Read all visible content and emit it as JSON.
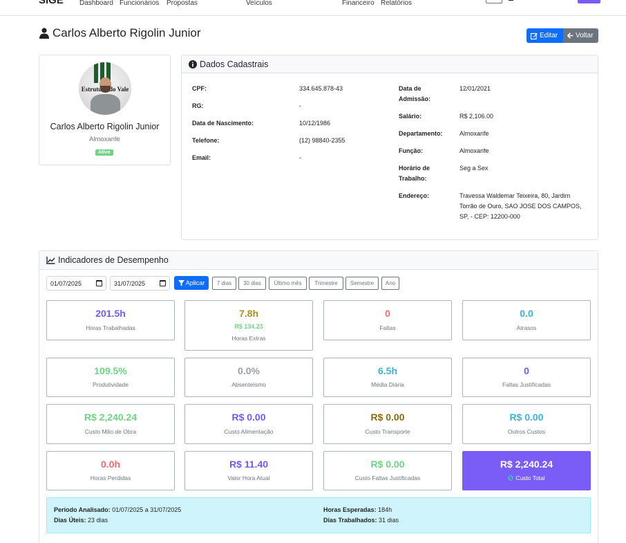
{
  "nav": {
    "brand": "SIGE",
    "links": [
      "Dashboard",
      "Funcionários",
      "Propostas",
      "Veículos",
      "Financeiro",
      "Relatórios"
    ]
  },
  "page": {
    "title": "Carlos Alberto Rigolin Junior",
    "edit_label": "Editar",
    "back_label": "Voltar"
  },
  "profile": {
    "name": "Carlos Alberto Rigolin Junior",
    "role": "Almoxarife",
    "status": "Ativo",
    "photo_text": "Estrutura do Vale"
  },
  "dados": {
    "header": "Dados Cadastrais",
    "left": [
      {
        "label": "CPF:",
        "value": "334.645.878-43"
      },
      {
        "label": "RG:",
        "value": "-"
      },
      {
        "label": "Data de Nascimento:",
        "value": "10/12/1986"
      },
      {
        "label": "Telefone:",
        "value": "(12) 98840-2355"
      },
      {
        "label": "Email:",
        "value": "-"
      }
    ],
    "right": [
      {
        "label1": "Data de",
        "label2": "Admissão:",
        "value": "12/01/2021"
      },
      {
        "label1": "Salário:",
        "label2": "",
        "value": "R$ 2,106.00"
      },
      {
        "label1": "Departamento:",
        "label2": "",
        "value": "Almoxarife"
      },
      {
        "label1": "Função:",
        "label2": "",
        "value": "Almoxarife"
      },
      {
        "label1": "Horário de",
        "label2": "Trabalho:",
        "value": "Seg a Sex"
      }
    ],
    "endereco_label": "Endereço:",
    "endereco_lines": [
      "Travessa Waldemar Teixeira, 80, Jardim",
      "Torrão de Ouro, SAO JOSE DOS CAMPOS,",
      "SP, - CEP: 12200-000"
    ]
  },
  "indicadores": {
    "header": "Indicadores de Desempenho",
    "date_start": "01/07/2025",
    "date_end": "31/07/2025",
    "apply_label": "Aplicar",
    "ranges": [
      "7 dias",
      "30 dias",
      "Último mês",
      "Trimestre",
      "Semestre",
      "Ano"
    ],
    "metrics": [
      {
        "value": "201.5h",
        "label": "Horas Trabalhadas",
        "sub": "",
        "color": "#6f5cf2"
      },
      {
        "value": "7.8h",
        "label": "Horas Extras",
        "sub": "R$ 134.23",
        "color": "#b08d16"
      },
      {
        "value": "0",
        "label": "Faltas",
        "sub": "",
        "color": "#ee6c6c"
      },
      {
        "value": "0.0",
        "label": "Atrasos",
        "sub": "",
        "color": "#3bb3d3"
      },
      {
        "value": "109.5%",
        "label": "Produtividade",
        "sub": "",
        "color": "#6ed383"
      },
      {
        "value": "0.0%",
        "label": "Absenteísmo",
        "sub": "",
        "color": "#9aa1a7"
      },
      {
        "value": "6.5h",
        "label": "Média Diária",
        "sub": "",
        "color": "#3bb3d3"
      },
      {
        "value": "0",
        "label": "Faltas Justificadas",
        "sub": "",
        "color": "#6f5cf2"
      },
      {
        "value": "R$ 2,240.24",
        "label": "Custo Mão de Obra",
        "sub": "",
        "color": "#6ed383"
      },
      {
        "value": "R$ 0.00",
        "label": "Custo Alimentação",
        "sub": "",
        "color": "#6f5cf2"
      },
      {
        "value": "R$ 0.00",
        "label": "Custo Transporte",
        "sub": "",
        "color": "#8a6d0b"
      },
      {
        "value": "R$ 0.00",
        "label": "Outros Custos",
        "sub": "",
        "color": "#3bb3d3"
      },
      {
        "value": "0.0h",
        "label": "Horas Perdidas",
        "sub": "",
        "color": "#ee6c6c"
      },
      {
        "value": "R$ 11.40",
        "label": "Valor Hora Atual",
        "sub": "",
        "color": "#6f5cf2"
      },
      {
        "value": "R$ 0.00",
        "label": "Custo Faltas Justificadas",
        "sub": "",
        "color": "#6ed383"
      },
      {
        "value": "R$ 2,240.24",
        "label": "Custo Total",
        "sub": "",
        "color": "#ffffff"
      }
    ],
    "summary": {
      "periodo_label": "Período Analisado:",
      "periodo_value": "01/07/2025 a 31/07/2025",
      "uteis_label": "Dias Úteis:",
      "uteis_value": "23 dias",
      "esperadas_label": "Horas Esperadas:",
      "esperadas_value": "184h",
      "trabalhados_label": "Dias Trabalhados:",
      "trabalhados_value": "31 dias"
    }
  }
}
